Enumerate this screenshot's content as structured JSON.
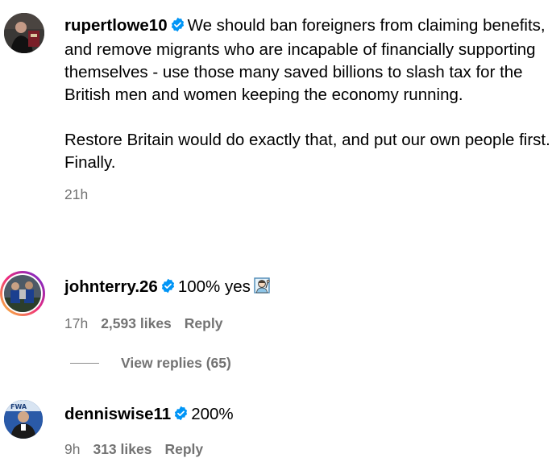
{
  "post": {
    "username": "rupertlowe10",
    "verified_icon": "verified-badge-icon",
    "paragraph1": "We should ban foreigners from claiming benefits, and remove migrants who are incapable of financially supporting themselves - use those many saved billions to slash tax for the British men and women keeping the economy running.",
    "paragraph2": "Restore Britain would do exactly that, and put our own people first.",
    "paragraph3": "Finally.",
    "time": "21h"
  },
  "comments": [
    {
      "username": "johnterry.26",
      "text": "100% yes",
      "emoji": "raised-hand-person-emoji",
      "time": "17h",
      "likes": "2,593 likes",
      "reply_label": "Reply",
      "view_replies": "View replies (65)"
    },
    {
      "username": "denniswise11",
      "text": "200%",
      "time": "9h",
      "likes": "313 likes",
      "reply_label": "Reply"
    }
  ],
  "colors": {
    "verified": "#0095f6",
    "meta": "#737373",
    "story_ring_start": "#f9ce34",
    "story_ring_end": "#c13584"
  }
}
